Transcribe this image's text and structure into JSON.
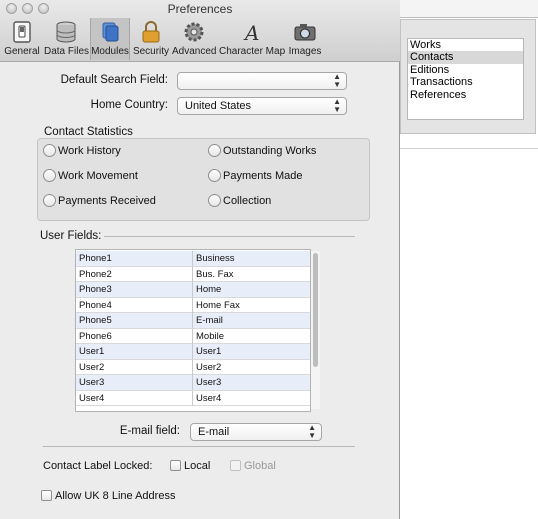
{
  "window": {
    "title": "Preferences"
  },
  "toolbar": {
    "items": [
      {
        "label": "General",
        "icon": "switch-icon"
      },
      {
        "label": "Data Files",
        "icon": "database-icon"
      },
      {
        "label": "Modules",
        "icon": "modules-icon",
        "selected": true
      },
      {
        "label": "Security",
        "icon": "lock-icon"
      },
      {
        "label": "Advanced",
        "icon": "gear-icon"
      },
      {
        "label": "Character Map",
        "icon": "character-map-icon"
      },
      {
        "label": "Images",
        "icon": "camera-icon"
      }
    ]
  },
  "form": {
    "default_search_label": "Default Search Field:",
    "default_search_value": "",
    "home_country_label": "Home Country:",
    "home_country_value": "United States"
  },
  "contact_statistics": {
    "title": "Contact Statistics",
    "options": [
      "Work History",
      "Outstanding Works",
      "Work Movement",
      "Payments Made",
      "Payments Received",
      "Collection"
    ]
  },
  "user_fields": {
    "title": "User Fields:",
    "rows": [
      [
        "Phone1",
        "Business"
      ],
      [
        "Phone2",
        "Bus. Fax"
      ],
      [
        "Phone3",
        "Home"
      ],
      [
        "Phone4",
        "Home Fax"
      ],
      [
        "Phone5",
        "E-mail"
      ],
      [
        "Phone6",
        "Mobile"
      ],
      [
        "User1",
        "User1"
      ],
      [
        "User2",
        "User2"
      ],
      [
        "User3",
        "User3"
      ],
      [
        "User4",
        "User4"
      ]
    ]
  },
  "email_field": {
    "label": "E-mail field:",
    "value": "E-mail"
  },
  "contact_label": {
    "label": "Contact Label Locked:",
    "local": "Local",
    "global": "Global"
  },
  "uk_address": {
    "label": "Allow UK 8 Line Address"
  },
  "background_list": {
    "items": [
      "Works",
      "Contacts",
      "Editions",
      "Transactions",
      "References"
    ],
    "selected": "Contacts"
  },
  "colors": {
    "row_alt": "#e8eef9",
    "selected_toolbar": "#c4c4c4",
    "window_bg": "#ececec"
  }
}
